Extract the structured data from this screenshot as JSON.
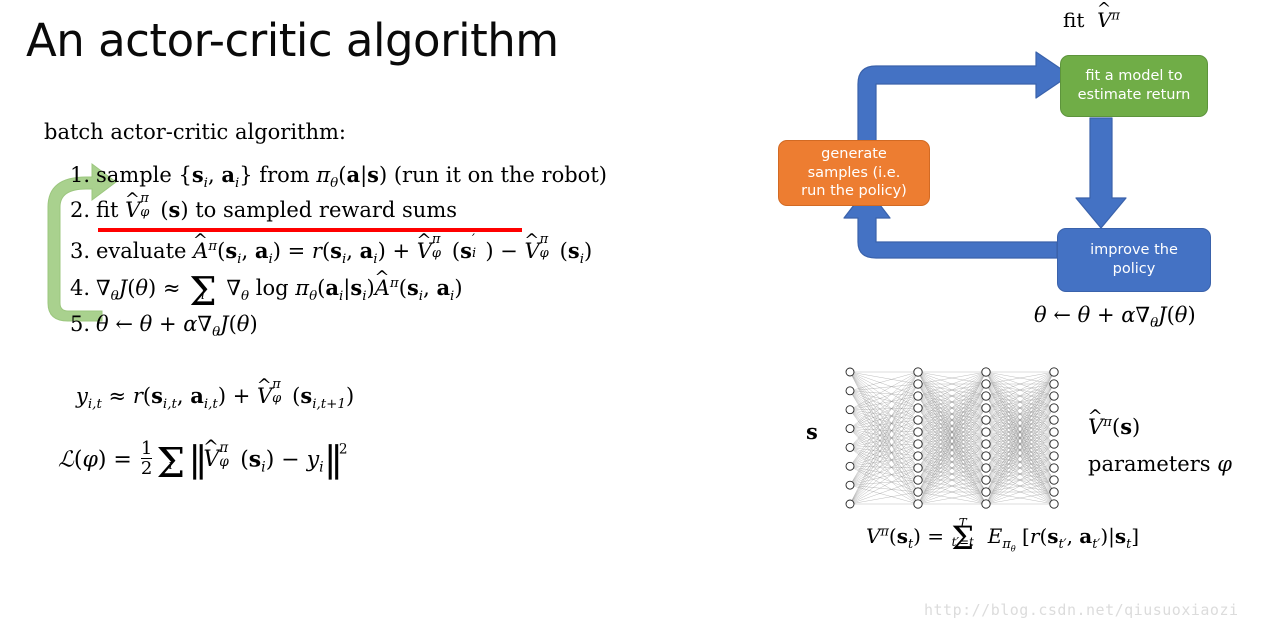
{
  "slide": {
    "title": "An actor-critic algorithm"
  },
  "algorithm": {
    "heading": "batch actor-critic algorithm:",
    "steps": [
      {
        "number": "1.",
        "text": "sample {s_i, a_i} from π_θ(a|s) (run it on the robot)",
        "underlined": false
      },
      {
        "number": "2.",
        "text": "fit V̂^π_φ(s) to sampled reward sums",
        "underlined": true
      },
      {
        "number": "3.",
        "text": "evaluate Â^π(s_i, a_i) = r(s_i, a_i) + V̂^π_φ(s'_i) − V̂^π_φ(s_i)",
        "underlined": false
      },
      {
        "number": "4.",
        "text": "∇_θ J(θ) ≈ Σ_i ∇_θ log π_θ(a_i|s_i) Â^π(s_i, a_i)",
        "underlined": false
      },
      {
        "number": "5.",
        "text": "θ ← θ + α∇_θ J(θ)",
        "underlined": false
      }
    ],
    "loop_arrow_color": "#A9D18E",
    "underline_color": "#FF0000"
  },
  "equations": {
    "target": "y_{i,t} ≈ r(s_{i,t}, a_{i,t}) + V̂^π_φ(s_{i,t+1})",
    "loss": "L(φ) = (1/2) Σ_i || V̂^π_φ(s_i) − y_i ||^2",
    "theta_update": "θ ← θ + α∇_θ J(θ)",
    "value_function": "V^π(s_t) = Σ_{t'=t}^{T} E_{π_θ}[ r(s_{t'}, a_{t'}) | s_t ]"
  },
  "flow_diagram": {
    "caption": "fit V̂^π",
    "boxes": [
      {
        "id": "green",
        "label_line1": "fit a model to",
        "label_line2": "estimate return",
        "color": "#70AD47"
      },
      {
        "id": "orange",
        "label_line1": "generate",
        "label_line2": "samples (i.e.",
        "label_line3": "run the policy)",
        "color": "#ED7D31"
      },
      {
        "id": "blue",
        "label_line1": "improve the",
        "label_line2": "policy",
        "color": "#4472C4"
      }
    ],
    "arrow_color": "#4472C4",
    "arrows": [
      {
        "name": "orange-to-green",
        "shape": "elbow-up-right"
      },
      {
        "name": "green-to-blue",
        "shape": "straight-down"
      },
      {
        "name": "blue-to-orange",
        "shape": "elbow-left-up"
      }
    ]
  },
  "neural_network": {
    "input_label": "s",
    "output_label_line1": "V̂^π(s)",
    "output_label_line2": "parameters φ",
    "layer_sizes": [
      8,
      12,
      12,
      12
    ]
  },
  "watermark": {
    "text": "http://blog.csdn.net/qiusuoxiaozi"
  }
}
